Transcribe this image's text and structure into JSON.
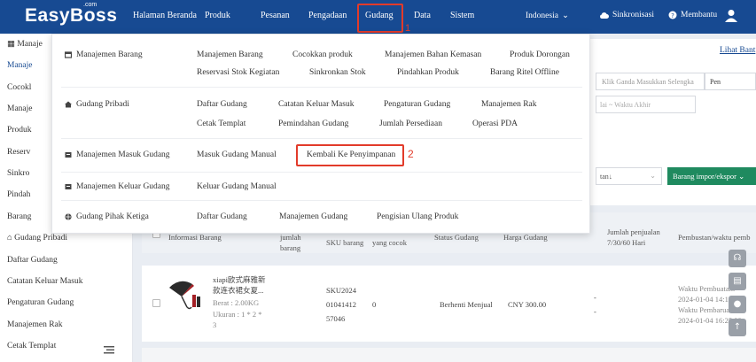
{
  "app": {
    "logo": "EasyBoss",
    "logo_suffix": ".com"
  },
  "topnav": {
    "items": [
      "Halaman Beranda",
      "Produk",
      "Pesanan",
      "Pengadaan",
      "Gudang",
      "Data",
      "Sistem"
    ],
    "active": "Gudang",
    "annotation": "1",
    "region": "Indonesia",
    "sync": "Sinkronisasi",
    "help": "Membantu"
  },
  "sidebar": {
    "items": [
      "Manaje",
      "Manaje",
      "Cocokl",
      "Manaje",
      "Produk",
      "Reserv",
      "Sinkro",
      "Pindah",
      "Barang",
      "Gudang Pribadi",
      "Daftar Gudang",
      "Catatan Keluar Masuk",
      "Pengaturan Gudang",
      "Manajemen Rak",
      "Cetak Templat"
    ]
  },
  "main": {
    "lihat": "Lihat Bant",
    "search_placeholder": "Klik Ganda Masukkan Selengka",
    "search_btn": "Pen",
    "date_placeholder": "lai  ~  Waktu Akhir",
    "sort_label": "tan↓",
    "impor_btn": "Barang impor/ekspor",
    "table": {
      "headers": [
        "Informasi Barang",
        "jumlah barang",
        "SKU barang",
        "yang cocok",
        "Status Gudang",
        "Harga Gudang",
        "Jumlah penjualan 7/30/60 Hari",
        "Pembustan/waktu pemb"
      ],
      "row": {
        "name_line1": "xiapi欧式麻雅新",
        "name_line2": "款连衣裙女夏...",
        "berat": "Berat : 2.00KG",
        "ukuran": "Ukuran : 1 * 2 *",
        "ukuran2": "3",
        "sku1": "SKU2024",
        "sku2": "01041412",
        "sku3": "57046",
        "match": "0",
        "status": "Berhenti Menjual",
        "price": "CNY 300.00",
        "sales": "-",
        "sales2": "-",
        "w1": "Waktu Pembuatan:",
        "w2": "2024-01-04 14:14:08",
        "w3": "Waktu Pembaruan:",
        "w4": "2024-01-04 16:25:32"
      }
    }
  },
  "dropdown": {
    "sections": [
      {
        "category": "Manajemen Barang",
        "links": [
          "Manajemen Barang",
          "Cocokkan produk",
          "Manajemen Bahan Kemasan",
          "Produk Dorongan",
          "Reservasi Stok Kegiatan",
          "Sinkronkan Stok",
          "Pindahkan Produk",
          "Barang Ritel Offline"
        ]
      },
      {
        "category": "Gudang Pribadi",
        "links": [
          "Daftar Gudang",
          "Catatan Keluar Masuk",
          "Pengaturan Gudang",
          "Manajemen Rak",
          "Cetak Templat",
          "Pemindahan Gudang",
          "Jumlah Persediaan",
          "Operasi PDA"
        ]
      },
      {
        "category": "Manajemen Masuk Gudang",
        "links": [
          "Masuk Gudang Manual",
          "Kembali Ke Penyimpanan"
        ]
      },
      {
        "category": "Manajemen Keluar Gudang",
        "links": [
          "Keluar Gudang Manual"
        ]
      },
      {
        "category": "Gudang Pihak Ketiga",
        "links": [
          "Daftar Gudang",
          "Manajemen Gudang",
          "Pengisian Ulang Produk"
        ]
      }
    ],
    "annotation": "2"
  },
  "colors": {
    "header": "#174a92",
    "highlight": "#e23b2a",
    "primary_btn": "#1f8a5f"
  }
}
